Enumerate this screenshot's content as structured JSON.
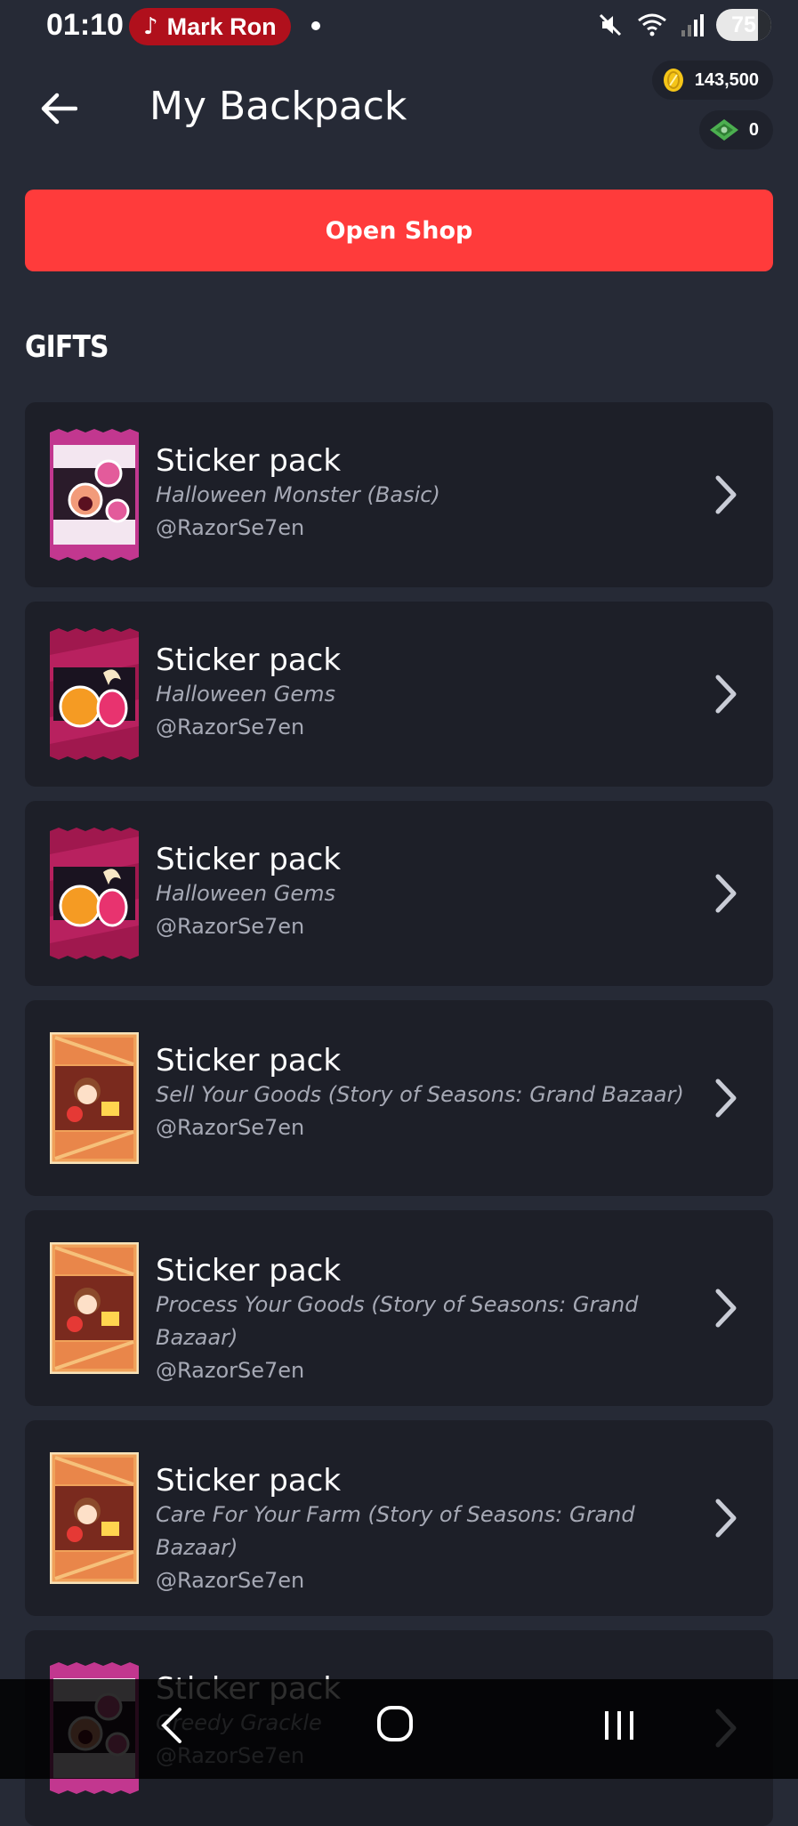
{
  "status_bar": {
    "time": "01:10",
    "media_label": "Mark Ron",
    "battery": "75",
    "battery_level": 0.75
  },
  "header": {
    "title": "My Backpack",
    "coins": "143,500",
    "cash": "0"
  },
  "open_shop_label": "Open Shop",
  "section_title": "GIFTS",
  "gifts": [
    {
      "name": "Sticker pack",
      "pack": "Halloween Monster (Basic)",
      "sender": "@RazorSe7en",
      "thumb": "halloween-monster"
    },
    {
      "name": "Sticker pack",
      "pack": "Halloween Gems",
      "sender": "@RazorSe7en",
      "thumb": "halloween-gems"
    },
    {
      "name": "Sticker pack",
      "pack": "Halloween Gems",
      "sender": "@RazorSe7en",
      "thumb": "halloween-gems"
    },
    {
      "name": "Sticker pack",
      "pack": "Sell Your Goods (Story of Seasons: Grand Bazaar)",
      "sender": "@RazorSe7en",
      "thumb": "crate"
    },
    {
      "name": "Sticker pack",
      "pack": "Process Your Goods (Story of Seasons: Grand Bazaar)",
      "sender": "@RazorSe7en",
      "thumb": "crate"
    },
    {
      "name": "Sticker pack",
      "pack": "Care For Your Farm (Story of Seasons: Grand Bazaar)",
      "sender": "@RazorSe7en",
      "thumb": "crate"
    },
    {
      "name": "Sticker pack",
      "pack": "Greedy Grackle",
      "sender": "@RazorSe7en",
      "thumb": "halloween-monster"
    }
  ],
  "icons": {
    "back": "arrow-left-icon",
    "chevron": "chevron-right-icon",
    "coin": "coin-icon",
    "cash": "cash-icon",
    "nav_back": "nav-back-icon",
    "nav_home": "nav-home-icon",
    "nav_recents": "nav-recents-icon"
  },
  "colors": {
    "background": "#262a36",
    "card": "#1d1f28",
    "accent": "#ff3b3b",
    "muted_text": "#a6a9b5"
  }
}
